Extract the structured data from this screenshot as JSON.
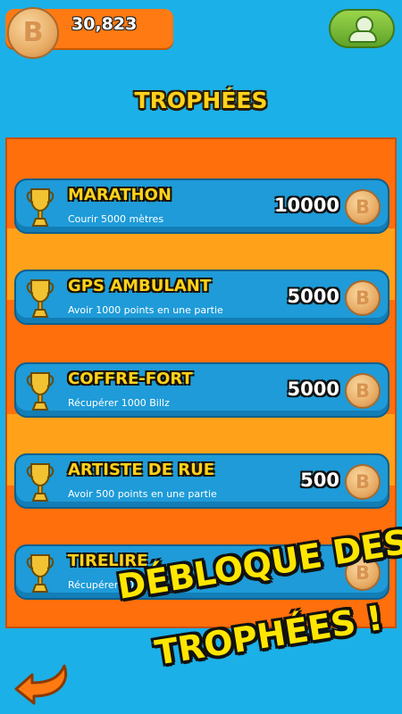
{
  "header": {
    "coins": "30,823",
    "coin_symbol": "B"
  },
  "title": "TROPHÉES",
  "trophies": [
    {
      "name": "MARATHON",
      "description": "Courir 5000 mètres",
      "reward": "10000"
    },
    {
      "name": "GPS AMBULANT",
      "description": "Avoir 1000 points en une partie",
      "reward": "5000"
    },
    {
      "name": "COFFRE-FORT",
      "description": "Récupérer 1000 Billz",
      "reward": "5000"
    },
    {
      "name": "ARTISTE DE RUE",
      "description": "Avoir 500 points en une partie",
      "reward": "500"
    },
    {
      "name": "TIRELIRE",
      "description": "Récupérer 200 Billz",
      "reward": ""
    }
  ],
  "promo": {
    "line1": "DÉBLOQUE DES",
    "line2": "TROPHÉES !"
  },
  "colors": {
    "background": "#1bb0e8",
    "panel": "#ff6f0c",
    "row": "#1e9bd8",
    "title": "#ffd21a",
    "promo": "#ffe600"
  },
  "icons": {
    "profile": "profile-icon",
    "trophy": "trophy-icon",
    "coin": "billz-coin-icon",
    "back": "back-arrow-icon"
  }
}
